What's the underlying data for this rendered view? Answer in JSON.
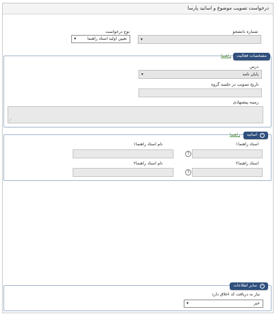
{
  "window": {
    "title": "درخواست تصویب موضوع و اساتید پارسا"
  },
  "request_form": {
    "student_number_label": "شماره دانشجو",
    "student_number_arrow": "▾",
    "request_type_label": "نوع درخواست",
    "request_type_value": "تعیین اولیه استاد راهنما",
    "request_type_arrow": "▾"
  },
  "activity_panel": {
    "title": "مشخصات فعالیت",
    "guide_link": "راهنما",
    "course_label": "درس",
    "course_value": "پایان نامه",
    "course_arrow": "▾",
    "approval_date_label": "تاریخ تصویب در جلسه گروه",
    "proposed_field_label": "زمینه پیشنهادی"
  },
  "professors_panel": {
    "title": "اساتید",
    "collapse_icon": "⊖",
    "guide_link": "راهنما",
    "advisor1_label": "استاد راهنما۱",
    "advisor1_name_label": "نام استاد راهنما۱",
    "advisor2_label": "استاد راهنما۲",
    "advisor2_name_label": "نام استاد راهنما۲",
    "help_glyph": "?"
  },
  "other_panel": {
    "title": "سایر اطلاعات",
    "collapse_icon": "⊖",
    "ethics_label": "نیاز به دریافت کد اخلاق دارد",
    "ethics_value": "خیر",
    "ethics_arrow": "▾"
  }
}
